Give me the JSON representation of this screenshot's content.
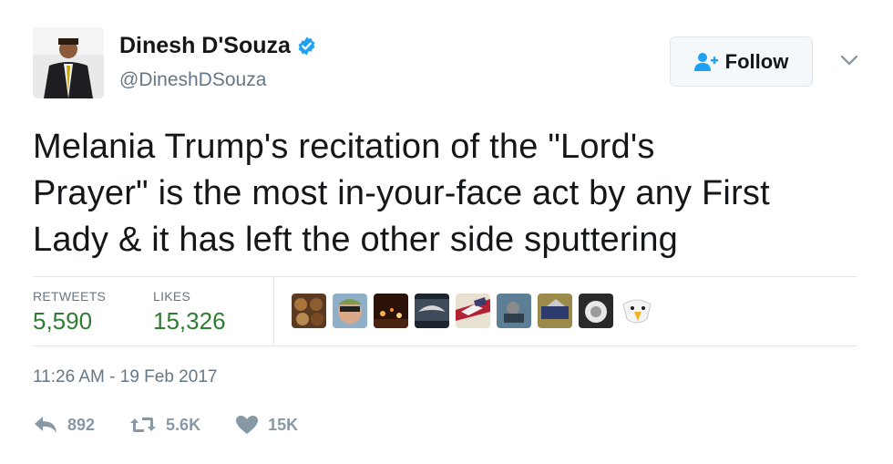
{
  "user": {
    "name": "Dinesh D'Souza",
    "handle": "@DineshDSouza"
  },
  "follow": {
    "label": "Follow"
  },
  "tweet": {
    "text_lines": [
      "Melania Trump's recitation of the \"Lord's",
      "Prayer\" is the most in-your-face act by any First",
      "Lady & it has left the other side sputtering"
    ],
    "timestamp": "11:26 AM - 19 Feb 2017"
  },
  "stats": {
    "retweets_label": "RETWEETS",
    "retweets_value": "5,590",
    "likes_label": "LIKES",
    "likes_value": "15,326"
  },
  "actions": {
    "reply_count": "892",
    "retweet_count": "5.6K",
    "like_count": "15K"
  },
  "colors": {
    "text": "#14171a",
    "muted": "#657786",
    "verified": "#1da1f2",
    "stat_value": "#2e7d32",
    "action_icon": "#8899a6"
  }
}
